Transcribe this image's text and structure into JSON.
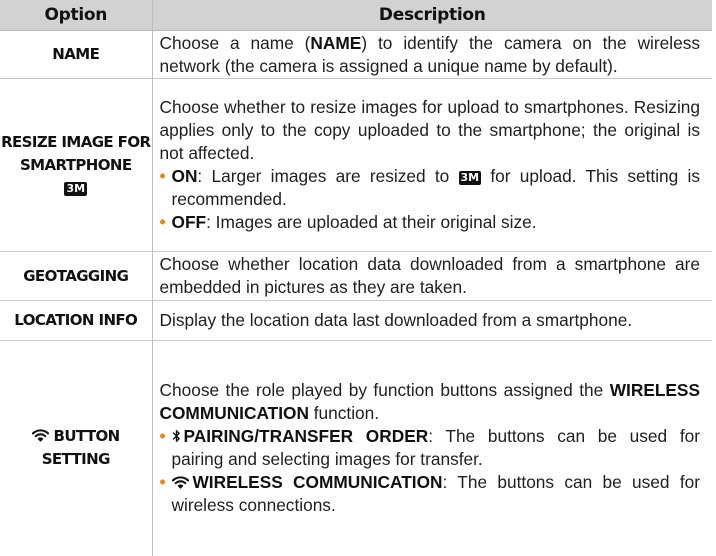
{
  "header": {
    "col_option": "Option",
    "col_description": "Description"
  },
  "rows": [
    {
      "option": "NAME",
      "desc_pre": "Choose a name (",
      "desc_bold": "NAME",
      "desc_post": ") to identify the camera on the wireless network (the camera is assigned a unique name by default)."
    },
    {
      "option_line1": "RESIZE IMAGE FOR",
      "option_line2": "SMARTPHONE",
      "option_badge": "3M",
      "desc_intro": "Choose whether to resize images for upload to smartphones. Resizing applies only to the copy uploaded to the smartphone; the original is not affected.",
      "bullets": [
        {
          "label": "ON",
          "text_pre": ": Larger images are resized to ",
          "badge": "3M",
          "text_post": " for upload. This setting is recommended."
        },
        {
          "label": "OFF",
          "text": ": Images are uploaded at their original size."
        }
      ]
    },
    {
      "option": "GEOTAGGING",
      "desc": "Choose whether location data downloaded from a smartphone are embedded in pictures as they are taken."
    },
    {
      "option": "LOCATION INFO",
      "desc": "Display the location data last downloaded from a smartphone."
    },
    {
      "option_line1": "BUTTON",
      "option_line2": "SETTING",
      "option_icon": "wifi-icon",
      "desc_pre": "Choose the role played by function buttons assigned the ",
      "desc_bold": "WIRELESS COMMUNICATION",
      "desc_post": " function.",
      "bullets": [
        {
          "icon": "bluetooth-icon",
          "label": "PAIRING/TRANSFER ORDER",
          "text": ": The buttons can be used for pairing and selecting images for transfer."
        },
        {
          "icon": "wifi-icon",
          "label": "WIRELESS COMMUNICATION",
          "text": ": The buttons can be used for wireless connections."
        }
      ]
    }
  ],
  "colors": {
    "header_bg": "#d2d2d2",
    "bullet": "#e08a1e",
    "text": "#1f1f1f"
  }
}
